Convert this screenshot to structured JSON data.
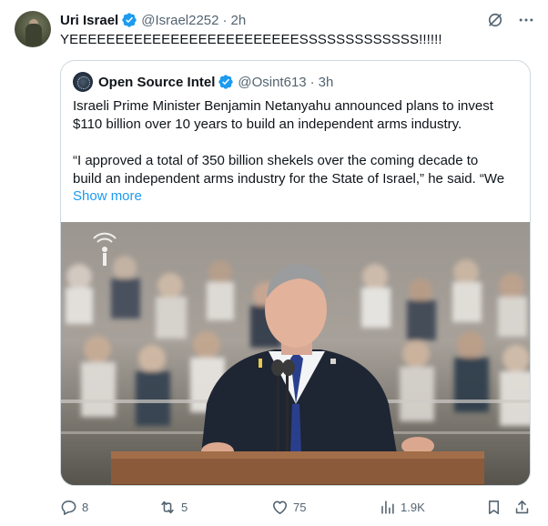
{
  "tweet": {
    "author_name": "Uri Israel",
    "handle": "@Israel2252",
    "separator": "·",
    "time": "2h",
    "text": "YEEEEEEEEEEEEEEEEEEEEEEEEESSSSSSSSSSSSS!!!!!!",
    "verified_color": "#1d9bf0"
  },
  "quote": {
    "author_name": "Open Source Intel",
    "handle": "@Osint613",
    "separator": "·",
    "time": "3h",
    "paragraph1_line1": "Israeli Prime Minister Benjamin Netanyahu announced plans to invest",
    "paragraph1_line2": "$110 billion over 10 years to build an independent arms industry.",
    "paragraph2_line1": "“I approved a total of 350 billion shekels over the coming decade to",
    "paragraph2_line2": "build an independent arms industry for the State of Israel,” he said. “We",
    "show_more": "Show more"
  },
  "actions": {
    "replies": "8",
    "reposts": "5",
    "likes": "75",
    "views": "1.9K"
  },
  "colors": {
    "accent": "#1d9bf0",
    "text_secondary": "#536471",
    "border": "#cfd9de"
  }
}
